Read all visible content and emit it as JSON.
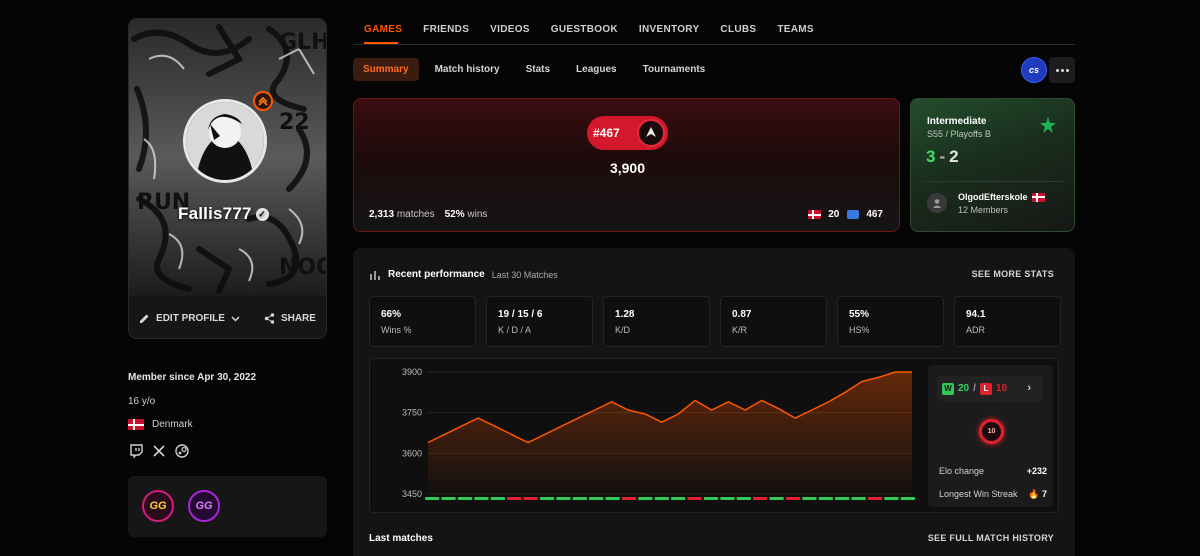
{
  "profile": {
    "nickname": "Fallis777",
    "level_badge": "^",
    "edit_label": "EDIT PROFILE",
    "share_label": "SHARE",
    "member_since": "Member since Apr 30, 2022",
    "age": "16 y/o",
    "country": "Denmark",
    "socials": [
      "twitch-icon",
      "x-icon",
      "steam-icon"
    ],
    "badges": [
      {
        "label": "GG",
        "color": "#d11e7a"
      },
      {
        "label": "GG",
        "color": "#a726d9"
      }
    ]
  },
  "top_tabs": [
    "GAMES",
    "FRIENDS",
    "VIDEOS",
    "GUESTBOOK",
    "INVENTORY",
    "CLUBS",
    "TEAMS"
  ],
  "sub_tabs": [
    "Summary",
    "Match history",
    "Stats",
    "Leagues",
    "Tournaments"
  ],
  "game_logo": "cs",
  "elo_card": {
    "rank": "#467",
    "elo": "3,900",
    "matches_value": "2,313",
    "matches_label": "matches",
    "wins_value": "52%",
    "wins_label": "wins",
    "country_rank": "20",
    "region_rank": "467"
  },
  "league": {
    "title": "Intermediate",
    "season": "S55 / Playoffs B",
    "wins": "3",
    "losses": "2",
    "dash": "-",
    "team_name": "OlgodEfterskole",
    "members": "12 Members"
  },
  "performance": {
    "title": "Recent performance",
    "subtitle": "Last 30 Matches",
    "see_more": "SEE MORE STATS",
    "stats": [
      {
        "value": "66%",
        "label": "Wins %"
      },
      {
        "value": "19 / 15 / 6",
        "label": "K / D / A"
      },
      {
        "value": "1.28",
        "label": "K/D"
      },
      {
        "value": "0.87",
        "label": "K/R"
      },
      {
        "value": "55%",
        "label": "HS%"
      },
      {
        "value": "94.1",
        "label": "ADR"
      }
    ],
    "wins": "20",
    "losses": "10",
    "slash": "/",
    "gauge_value": "10",
    "elo_change_label": "Elo change",
    "elo_change_value": "+232",
    "streak_label": "Longest Win Streak",
    "streak_value": "7",
    "last_matches": "Last matches",
    "see_full": "SEE FULL MATCH HISTORY"
  },
  "chart_data": {
    "type": "area",
    "y_ticks": [
      "3900",
      "3750",
      "3600",
      "3450"
    ],
    "ylim": [
      3450,
      3900
    ],
    "values": [
      3640,
      3670,
      3700,
      3730,
      3700,
      3670,
      3640,
      3670,
      3700,
      3730,
      3760,
      3790,
      3760,
      3745,
      3715,
      3745,
      3795,
      3760,
      3790,
      3760,
      3795,
      3765,
      3730,
      3760,
      3790,
      3825,
      3865,
      3880,
      3900,
      3900
    ],
    "results": [
      "W",
      "W",
      "W",
      "W",
      "W",
      "L",
      "L",
      "W",
      "W",
      "W",
      "W",
      "W",
      "L",
      "W",
      "W",
      "W",
      "L",
      "W",
      "W",
      "W",
      "L",
      "W",
      "L",
      "W",
      "W",
      "W",
      "W",
      "L",
      "W",
      "W"
    ],
    "line_color": "#ff5500",
    "win_color": "#32c95a",
    "loss_color": "#e0212f"
  }
}
